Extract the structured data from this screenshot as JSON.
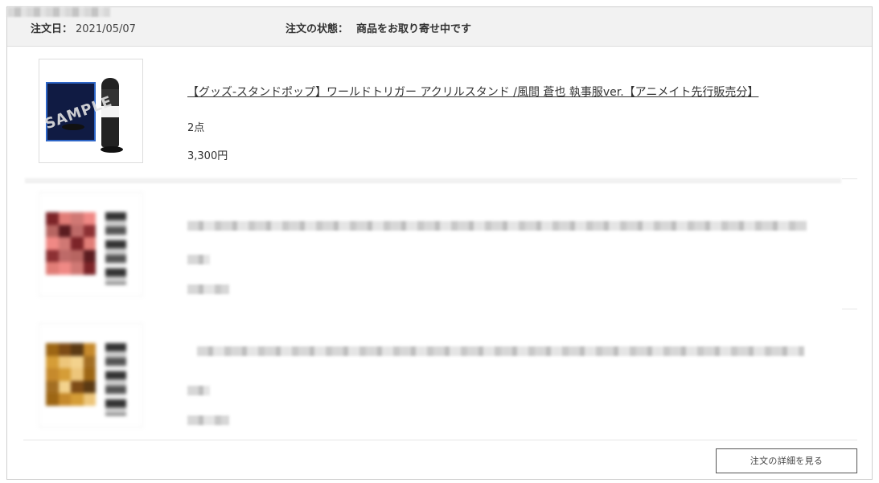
{
  "order": {
    "date_label": "注文日：",
    "date": "2021/05/07",
    "status_label": "注文の状態：",
    "status": "商品をお取り寄せ中です",
    "details_button": "注文の詳細を見る"
  },
  "items": [
    {
      "title": "【グッズ-スタンドポップ】ワールドトリガー アクリルスタンド /風間 蒼也 執事服ver.【アニメイト先行販売分】",
      "quantity": "2点",
      "price": "3,300円",
      "watermark": "SAMPLE",
      "thumbnail_icon": "acrylic-stand-image"
    },
    {
      "title": "",
      "quantity": "",
      "price": "",
      "thumbnail_icon": "blurred-product-image"
    },
    {
      "title": "",
      "quantity": "",
      "price": "",
      "thumbnail_icon": "blurred-product-image"
    }
  ]
}
